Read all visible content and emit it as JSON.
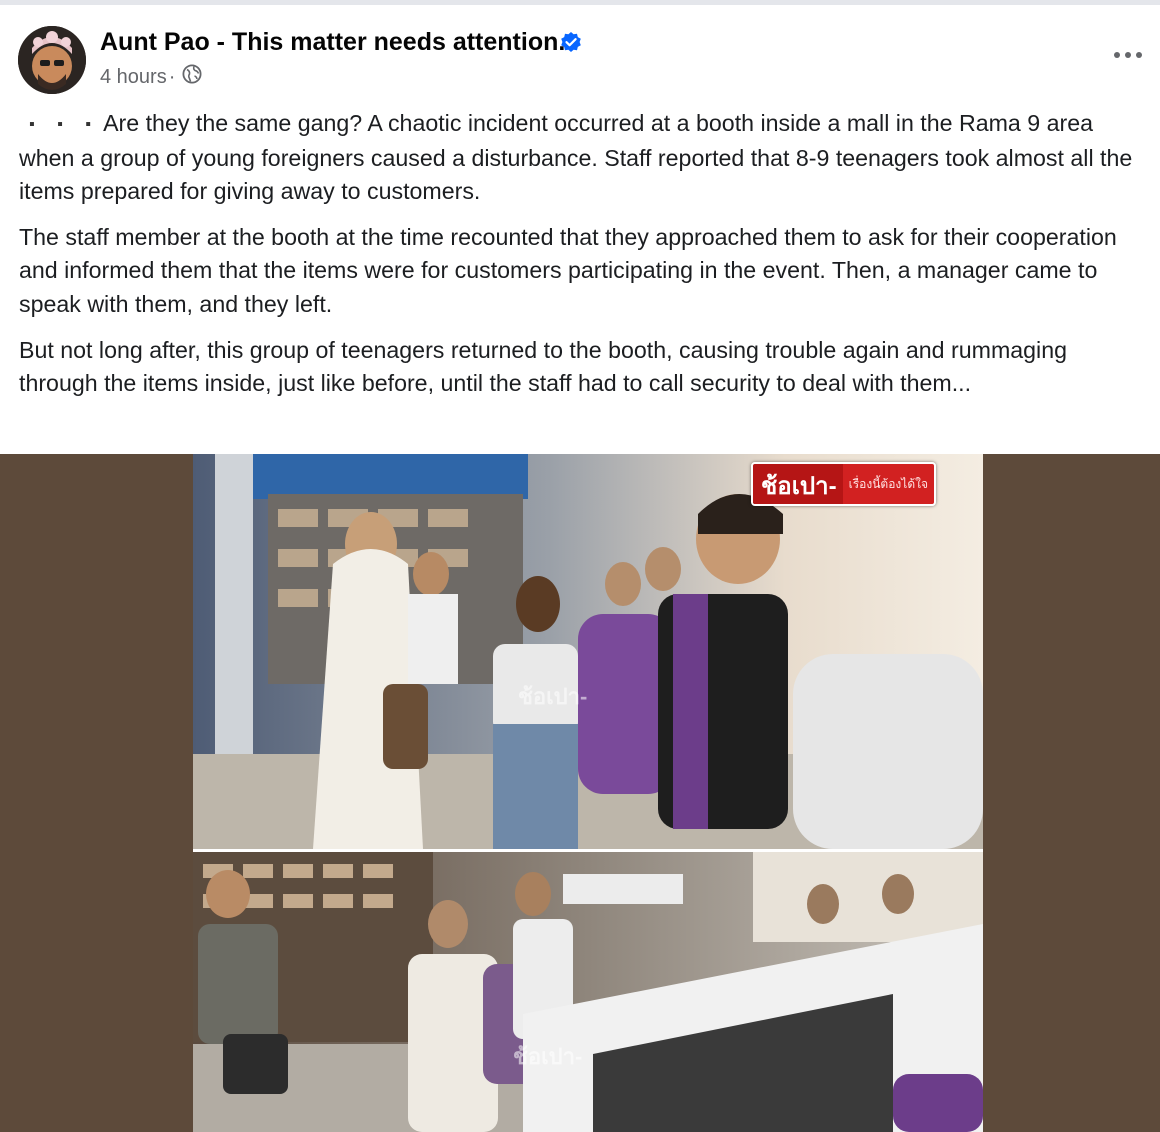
{
  "post": {
    "author": "Aunt Pao - This matter needs attention.",
    "time": "4 hours",
    "separator": "·",
    "verified_icon": "verified-badge-icon",
    "audience_icon": "globe-icon",
    "more_icon": "more-options-icon",
    "bullets": "▪ ▪ ▪",
    "paragraphs": [
      "Are they the same gang? A chaotic incident occurred at a booth inside a mall in the Rama 9 area when a group of young foreigners caused a disturbance. Staff reported that 8-9 teenagers took almost all the items prepared for giving away to customers.",
      "The staff member at the booth at the time recounted that they approached them to ask for their cooperation and informed them that the items were for customers participating in the event. Then, a manager came to speak with them, and they left.",
      "But not long after, this group of teenagers returned to the booth, causing trouble again and rummaging through the items inside, just like before, until the staff had to call security to deal with them..."
    ]
  },
  "media": {
    "watermark_main": "ช้อเปา-",
    "watermark_sub": "เรื่องนี้ต้องได้ใจ",
    "watermark_faint": "ช้อเปา-",
    "colors": {
      "frame_background": "#5d4a3a",
      "badge_red": "#b51515",
      "link_blue": "#0866ff"
    }
  }
}
